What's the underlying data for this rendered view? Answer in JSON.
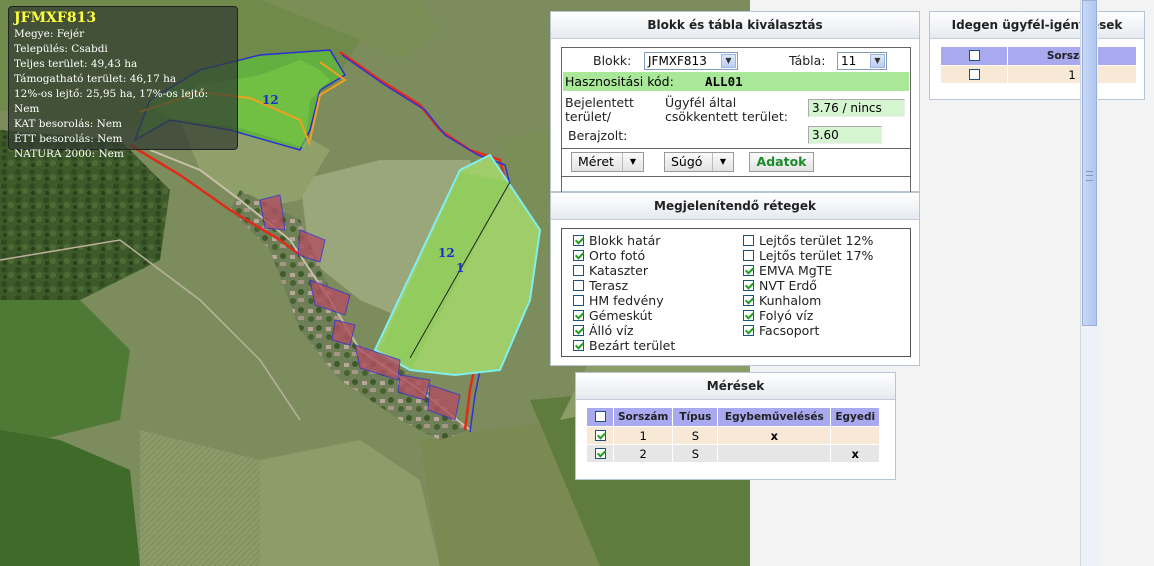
{
  "map": {
    "info": {
      "block_code": "JFMXF813",
      "lines": [
        "Megye: Fejér",
        "Település: Csabdi",
        "Teljes terület: 49,43 ha",
        "Támogatható terület: 46,17 ha",
        "12%-os lejtő: 25,95 ha, 17%-os lejtő: Nem",
        "KAT besorolás: Nem",
        "ÉTT besorolás: Nem",
        "NATURA 2000: Nem"
      ]
    },
    "labels": {
      "parcel_a": "12",
      "parcel_b": "12",
      "parcel_b_sub": "1"
    },
    "colors": {
      "block_border": "#3a2fd0",
      "red_border": "#e12b1a",
      "selected_parcel": "#7ef0f0",
      "orange_outline": "#f0a020"
    }
  },
  "blokk_panel": {
    "title": "Blokk és tábla kiválasztás",
    "blokk_label": "Blokk:",
    "blokk_value": "JFMXF813",
    "tabla_label": "Tábla:",
    "tabla_value": "11",
    "hasznositasi_label": "Hasznositási kód:",
    "hasznositasi_value": "ALL01",
    "bejelentett_label_1": "Bejelentett",
    "bejelentett_label_2": "terület/",
    "ugyfel_label_1": "Ügyfél által",
    "ugyfel_label_2": "csökkentett terület:",
    "bejelentett_value": "3.76 / nincs",
    "berajzolt_label": "Berajzolt:",
    "berajzolt_value": "3.60",
    "meret_button": "Méret",
    "sugo_button": "Súgó",
    "adatok_button": "Adatok"
  },
  "retegek_panel": {
    "title": "Megjelenítendő rétegek",
    "left": [
      {
        "label": "Blokk határ",
        "checked": true
      },
      {
        "label": "Orto fotó",
        "checked": true
      },
      {
        "label": "Kataszter",
        "checked": false
      },
      {
        "label": "Terasz",
        "checked": false
      },
      {
        "label": "HM fedvény",
        "checked": false
      },
      {
        "label": "Gémeskút",
        "checked": true
      },
      {
        "label": "Álló víz",
        "checked": true
      },
      {
        "label": "Bezárt terület",
        "checked": true
      }
    ],
    "right": [
      {
        "label": "Lejtős terület 12%",
        "checked": false
      },
      {
        "label": "Lejtős terület 17%",
        "checked": false
      },
      {
        "label": "EMVA MgTE",
        "checked": true
      },
      {
        "label": "NVT Erdő",
        "checked": true
      },
      {
        "label": "Kunhalom",
        "checked": true
      },
      {
        "label": "Folyó víz",
        "checked": true
      },
      {
        "label": "Facsoport",
        "checked": true
      }
    ]
  },
  "meresek_panel": {
    "title": "Mérések",
    "headers": [
      "Sorszám",
      "Típus",
      "Egybeművelésés",
      "Egyedi"
    ],
    "rows": [
      {
        "checked": true,
        "sorszam": "1",
        "tipus": "S",
        "egybe": "x",
        "egyedi": ""
      },
      {
        "checked": true,
        "sorszam": "2",
        "tipus": "S",
        "egybe": "",
        "egyedi": "x"
      }
    ]
  },
  "idegen_panel": {
    "title": "Idegen ügyfél-igénylések",
    "headers": [
      "Sorszám"
    ],
    "rows": [
      {
        "checked": false,
        "sorszam": "1"
      }
    ]
  }
}
